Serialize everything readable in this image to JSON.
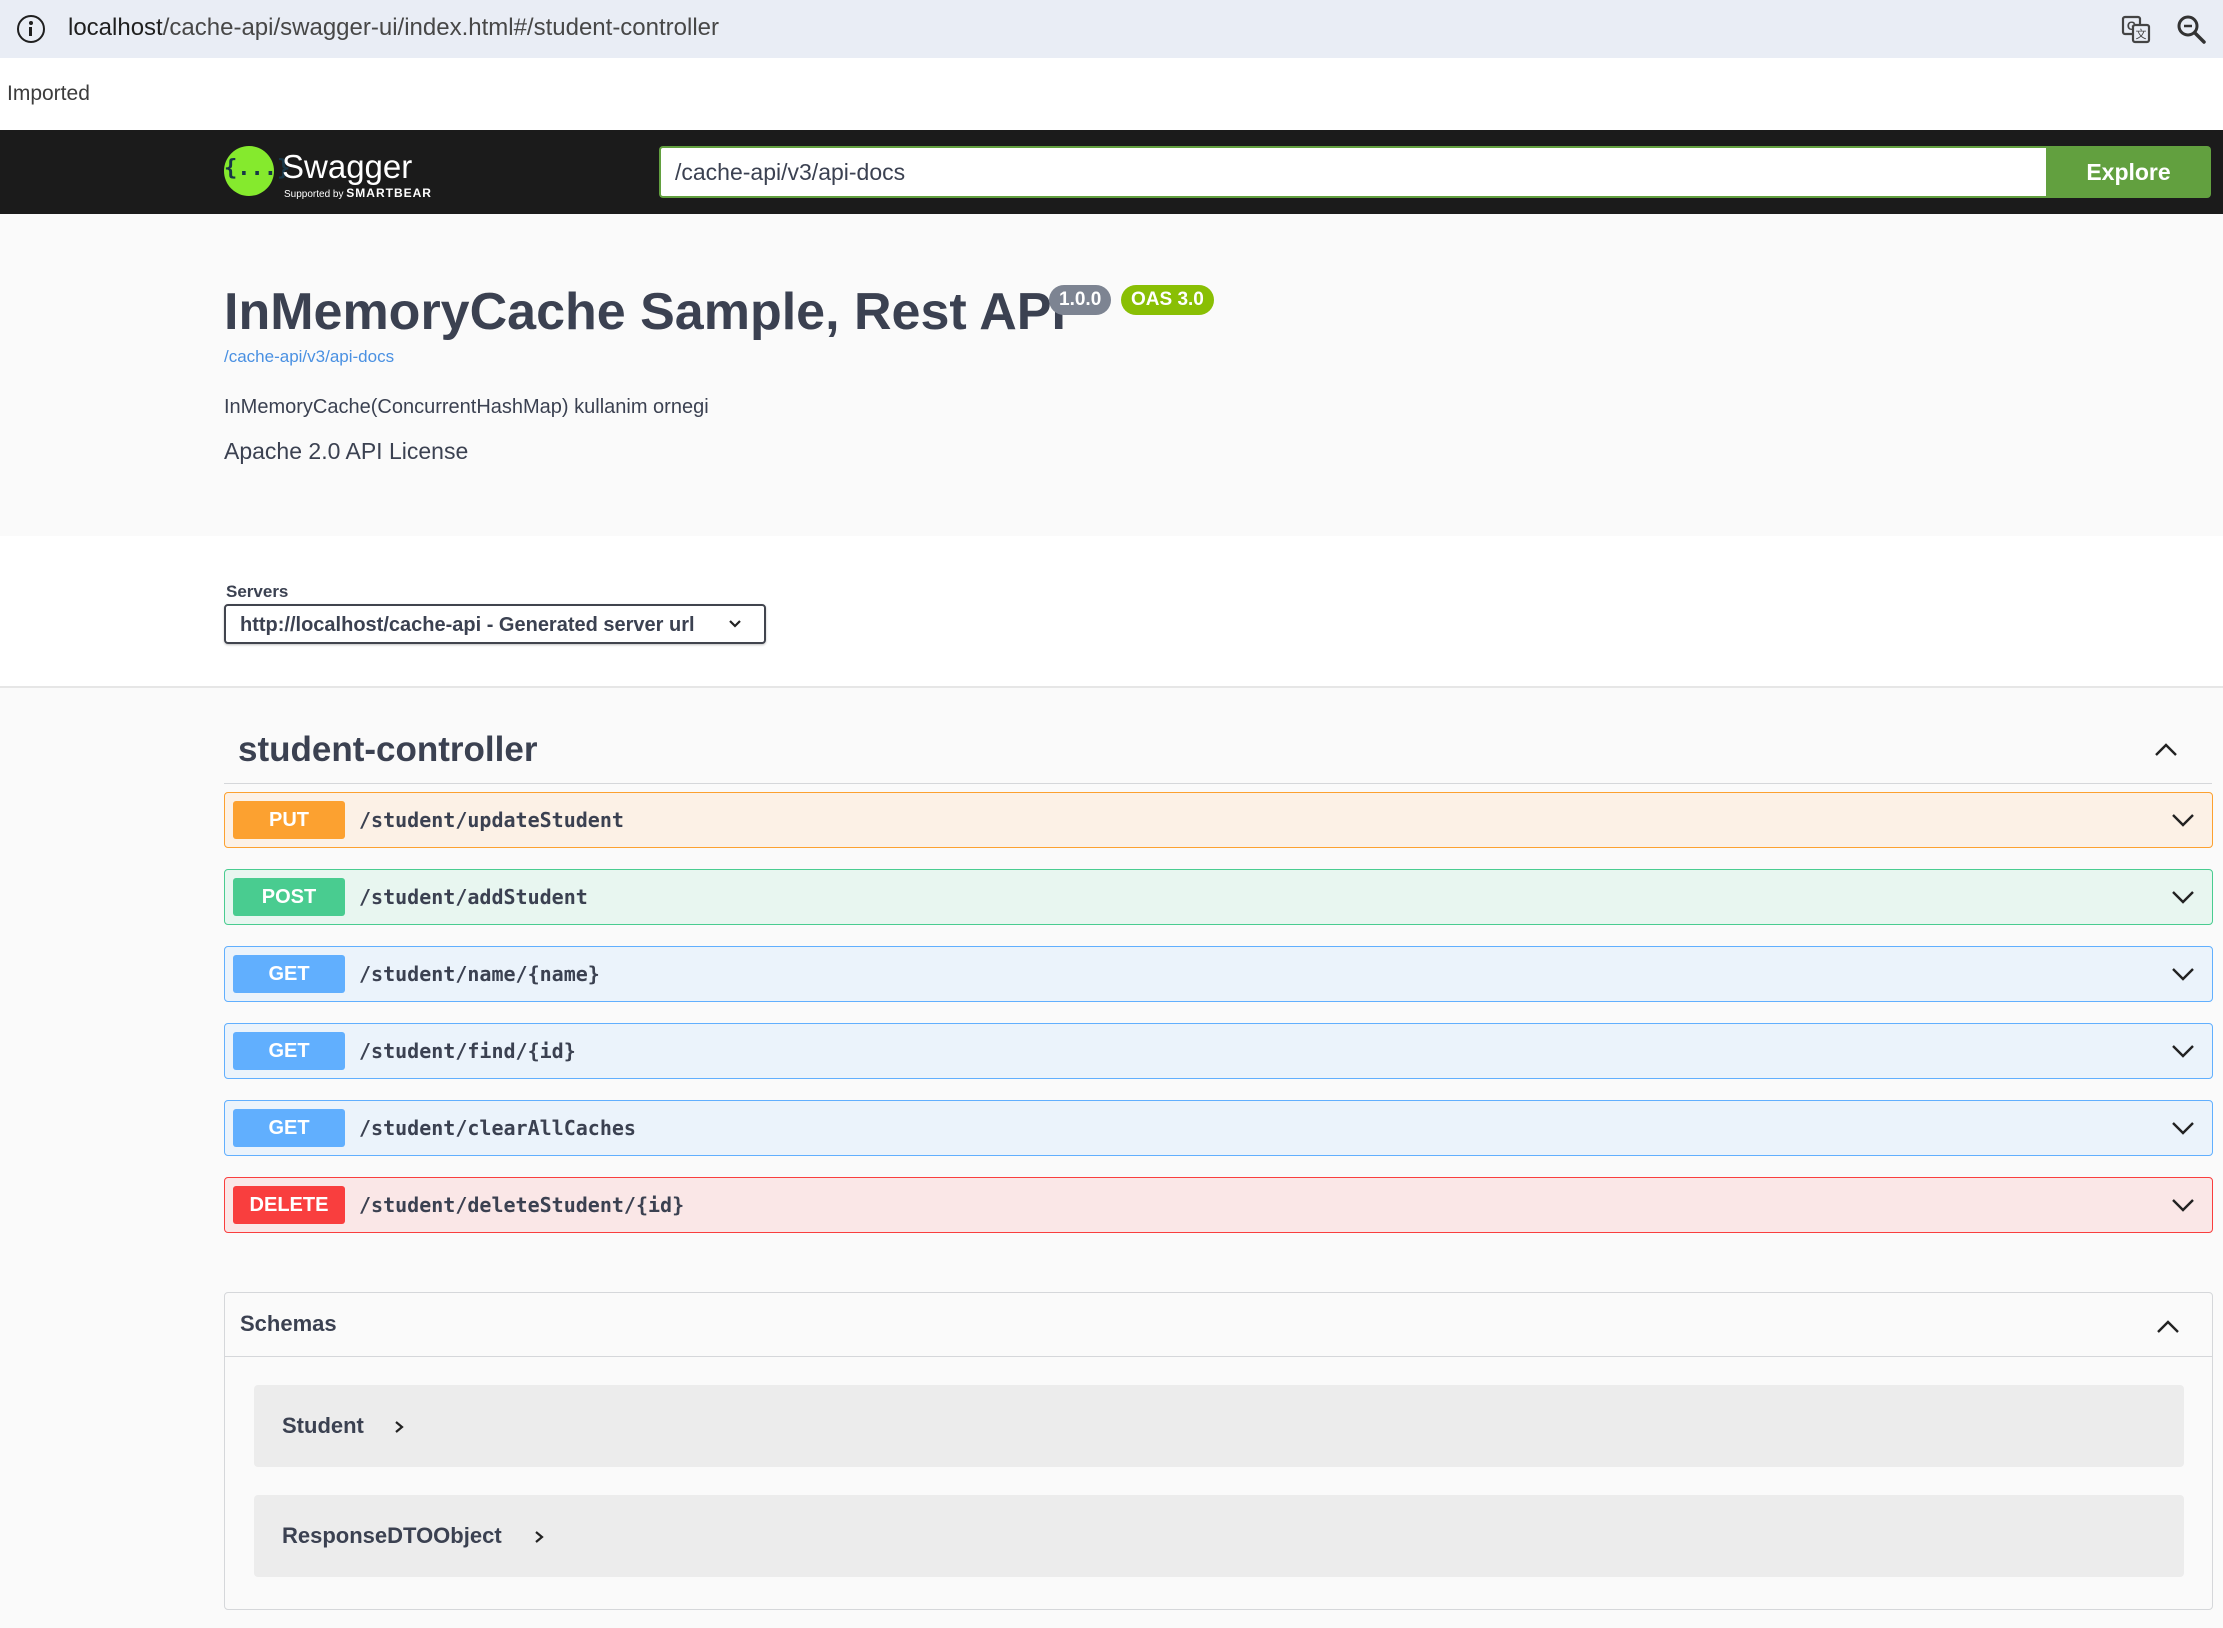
{
  "browser": {
    "url_host": "localhost",
    "url_path": "/cache-api/swagger-ui/index.html#/student-controller",
    "bookmark": "Imported"
  },
  "topbar": {
    "logo_text": "Swagger",
    "logo_glyph": "{...}",
    "logo_sub_prefix": "Supported by",
    "logo_sub_brand": "SMARTBEAR",
    "spec_url": "/cache-api/v3/api-docs",
    "explore_label": "Explore",
    "accent": "#62a03f"
  },
  "info": {
    "title": "InMemoryCache Sample, Rest API",
    "version": "1.0.0",
    "oas": "OAS 3.0",
    "spec_link": "/cache-api/v3/api-docs",
    "description": "InMemoryCache(ConcurrentHashMap) kullanim ornegi",
    "license": "Apache 2.0 API License"
  },
  "servers": {
    "label": "Servers",
    "selected": "http://localhost/cache-api - Generated server url"
  },
  "tag": {
    "name": "student-controller",
    "operations": [
      {
        "method": "PUT",
        "path": "/student/updateStudent",
        "color": "#fca130"
      },
      {
        "method": "POST",
        "path": "/student/addStudent",
        "color": "#49cc90"
      },
      {
        "method": "GET",
        "path": "/student/name/{name}",
        "color": "#61affe"
      },
      {
        "method": "GET",
        "path": "/student/find/{id}",
        "color": "#61affe"
      },
      {
        "method": "GET",
        "path": "/student/clearAllCaches",
        "color": "#61affe"
      },
      {
        "method": "DELETE",
        "path": "/student/deleteStudent/{id}",
        "color": "#f93e3e"
      }
    ]
  },
  "schemas": {
    "title": "Schemas",
    "models": [
      {
        "name": "Student"
      },
      {
        "name": "ResponseDTOObject"
      }
    ]
  },
  "icons": {
    "info": "info-icon",
    "translate": "translate-icon",
    "zoom": "zoom-icon",
    "collapse": "chevron-up-icon",
    "expand": "chevron-down-icon",
    "model_expand": "chevron-right-icon"
  }
}
